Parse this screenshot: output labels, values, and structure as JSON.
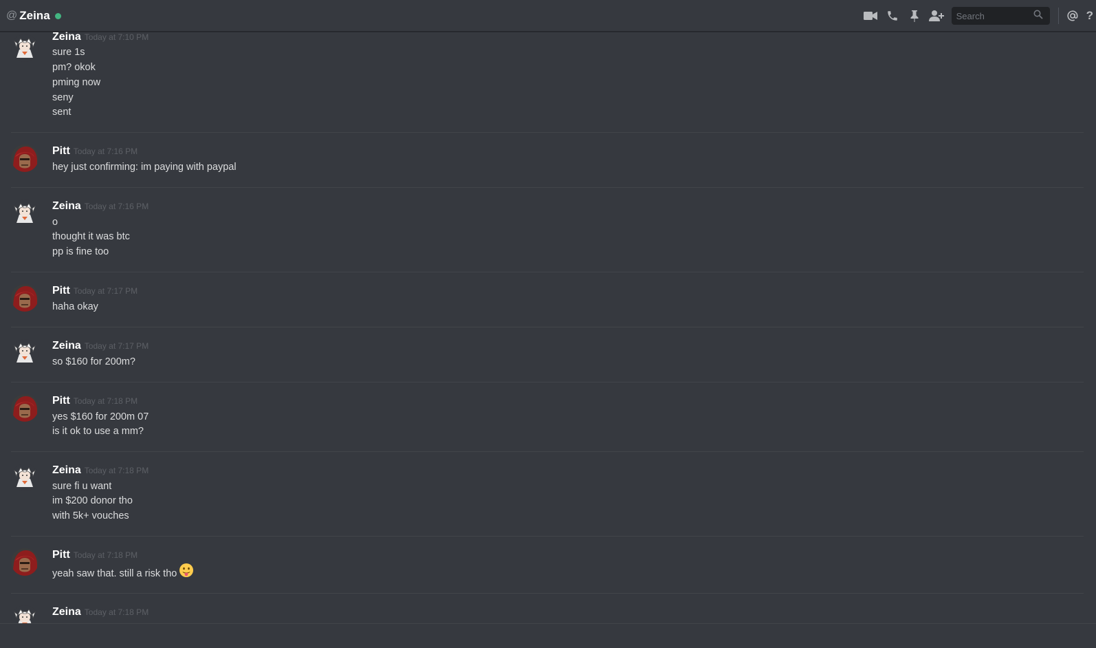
{
  "header": {
    "at_symbol": "@",
    "dm_name": "Zeina",
    "status": "online",
    "status_color": "#43b581",
    "search_placeholder": "Search",
    "icons": [
      "video-call-icon",
      "voice-call-icon",
      "pin-icon",
      "add-friend-icon",
      "search-icon",
      "mention-icon",
      "help-icon"
    ],
    "help_label": "?"
  },
  "colors": {
    "background": "#36393f",
    "text": "#dcddde",
    "username": "#ffffff",
    "timestamp": "#5d6066"
  },
  "messages": [
    {
      "author": "Zeina",
      "avatar": "zeina-avatar",
      "time": "Today at 7:10 PM",
      "lines": [
        "sure 1s",
        "pm? okok",
        "pming now",
        "seny",
        "sent"
      ]
    },
    {
      "author": "Pitt",
      "avatar": "pitt-avatar",
      "time": "Today at 7:16 PM",
      "lines": [
        "hey just confirming: im paying with paypal"
      ]
    },
    {
      "author": "Zeina",
      "avatar": "zeina-avatar",
      "time": "Today at 7:16 PM",
      "lines": [
        "o",
        "thought it was btc",
        "pp is fine too"
      ]
    },
    {
      "author": "Pitt",
      "avatar": "pitt-avatar",
      "time": "Today at 7:17 PM",
      "lines": [
        "haha okay"
      ]
    },
    {
      "author": "Zeina",
      "avatar": "zeina-avatar",
      "time": "Today at 7:17 PM",
      "lines": [
        "so $160 for 200m?"
      ]
    },
    {
      "author": "Pitt",
      "avatar": "pitt-avatar",
      "time": "Today at 7:18 PM",
      "lines": [
        "yes $160 for 200m 07",
        "is it ok to use a mm?"
      ]
    },
    {
      "author": "Zeina",
      "avatar": "zeina-avatar",
      "time": "Today at 7:18 PM",
      "lines": [
        "sure fi u want",
        "im $200 donor tho",
        "with 5k+ vouches"
      ]
    },
    {
      "author": "Pitt",
      "avatar": "pitt-avatar",
      "time": "Today at 7:18 PM",
      "lines": [
        "yeah saw that. still a risk tho"
      ],
      "emoji": "stuck-out-tongue-emoji"
    },
    {
      "author": "Zeina",
      "avatar": "zeina-avatar",
      "time": "Today at 7:18 PM",
      "lines": []
    }
  ]
}
